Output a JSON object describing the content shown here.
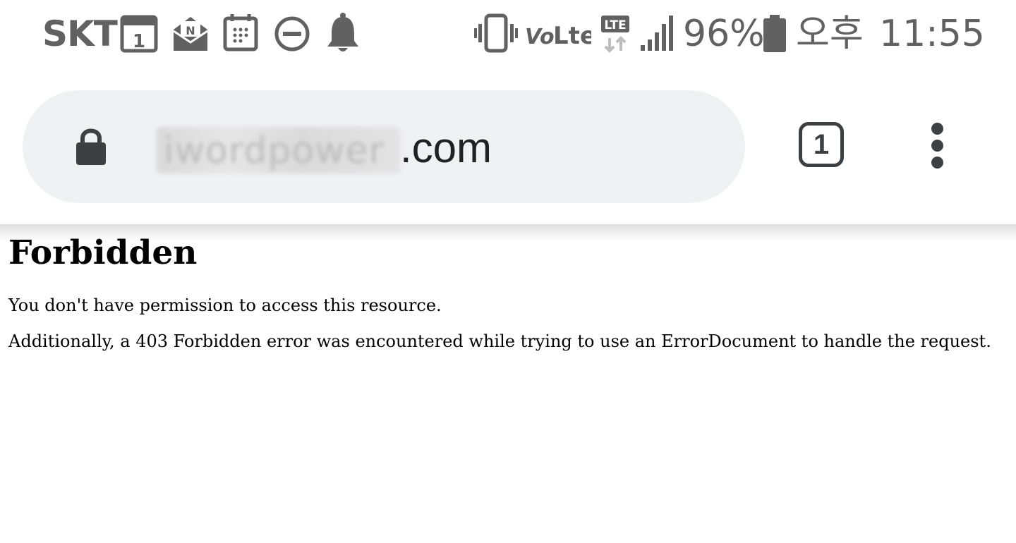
{
  "status_bar": {
    "carrier": "SKT",
    "calendar_day": "1",
    "mail_badge": "N",
    "network": "LTE",
    "battery": "96%",
    "ampm": "오후",
    "time": "11:55"
  },
  "toolbar": {
    "url_visible": ".com",
    "url_blurred": "iwordpower",
    "tab_count": "1"
  },
  "page": {
    "heading": "Forbidden",
    "line1": "You don't have permission to access this resource.",
    "line2": "Additionally, a 403 Forbidden error was encountered while trying to use an ErrorDocument to handle the request."
  }
}
